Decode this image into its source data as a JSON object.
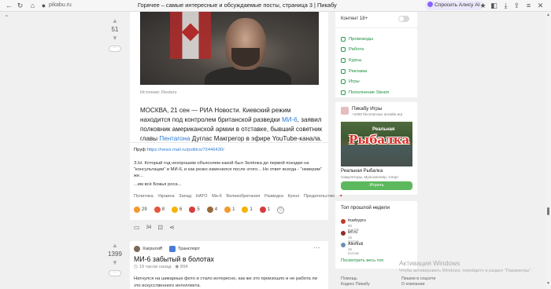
{
  "browser": {
    "url": "pikabu.ru",
    "title": "Горячее – самые интересные и обсуждаемые посты, страница 3 | Пикабу",
    "alice_label": "Спросить Алису AI"
  },
  "post1": {
    "votes": "51",
    "source": "Источник: Reuters",
    "text_before_link": "МОСКВА, 21 сен — РИА Новости. Киевский режим находится под контролем британской разведки ",
    "link1": "МИ-6",
    "text_middle": ", заявил полковник американской армии в отставке, бывший советник главы ",
    "link2": "Пентагона",
    "text_after": " Дуглас Макгрегор в эфире YouTube-канала.",
    "proof_label": "Пруф",
    "proof_url": "https://news.mail.ru/politics/72446430/",
    "comment": "З.Ы. Который год нехорошим объясняем какой был Зелёнка до первой поездки на \"консультации\" в МИ-6, и как резко изменился после этого... Но ответ всегда - \"неверим\" же...",
    "comment_tail": "...им всё Божья роса...",
    "tags": [
      "Политика",
      "Украина",
      "Запад",
      "НАТО",
      "Ми-6",
      "Великобритания",
      "Разведка",
      "Кукол",
      "Предательство"
    ],
    "reactions": [
      {
        "count": "29",
        "color": "#f29a2e"
      },
      {
        "count": "8",
        "color": "#e5553b"
      },
      {
        "count": "6",
        "color": "#f4b400"
      },
      {
        "count": "5",
        "color": "#d93c3c"
      },
      {
        "count": "4",
        "color": "#9a6a3a"
      },
      {
        "count": "1",
        "color": "#f29a2e"
      },
      {
        "count": "1",
        "color": "#f4b400"
      },
      {
        "count": "1",
        "color": "#d93c3c"
      }
    ],
    "comments_count": "34"
  },
  "post2": {
    "votes": "1399",
    "author": "Xarpunoff",
    "community": "Транспорт",
    "title": "МИ-6 забытый в болотах",
    "time": "19 часов назад",
    "views": "89К",
    "text": "Натнулся на шикарные фото и стало интересно, как же это произошло и не работа ли это искусственного интеллекта."
  },
  "sidebar": {
    "adult_label": "Контент 18+",
    "menu": [
      "Промокоды",
      "Работа",
      "Курсы",
      "Реклама",
      "Игры",
      "Пополнение Steam"
    ],
    "games_title": "Пикабу Игры",
    "games_sub": "+1000 бесплатных онлайн игр",
    "game_banner_small": "Реальная",
    "game_banner_big": "Рыбалка",
    "game_name": "Реальная Рыбалка",
    "game_genre": "Симуляторы, Мультиплеер, Спорт",
    "play_label": "Играть",
    "top_title": "Топ прошлой недели",
    "top": [
      {
        "name": "truebypru",
        "count": "86 постов",
        "color": "#c0392b"
      },
      {
        "name": "ief.ru",
        "count": "15 постов",
        "color": "#8e2d2d"
      },
      {
        "name": "Alexfudi",
        "count": "15 постов",
        "color": "#6b8fb3"
      }
    ],
    "top_all": "Посмотреть весь топ"
  },
  "footer": {
    "col1": [
      "Помощь",
      "Кодекс Пикабу"
    ],
    "col2": [
      "Пишем в соцсети",
      "О компании"
    ]
  },
  "watermark": {
    "line1": "Активация Windows",
    "line2": "Чтобы активировать Windows, перейдите в раздел \"Параметры\"."
  }
}
